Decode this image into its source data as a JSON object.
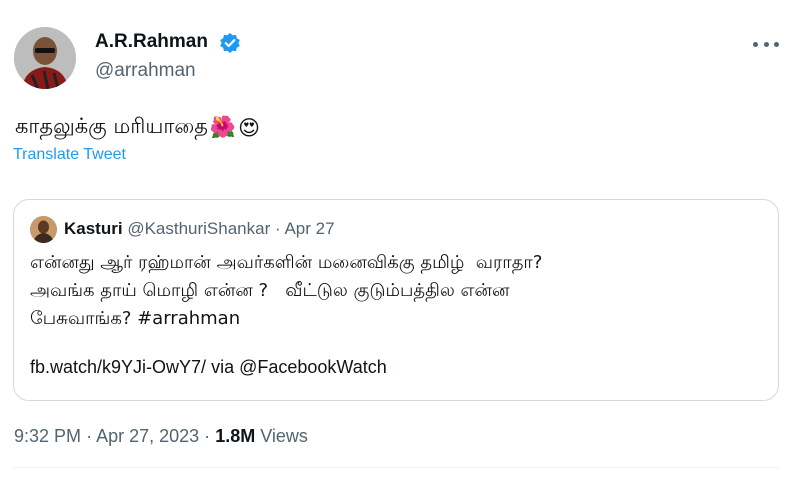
{
  "tweet": {
    "author_name": "A.R.Rahman",
    "author_handle": "@arrahman",
    "verified_icon": "verified-badge-icon",
    "more_icon": "more-options-icon",
    "text": "காதலுக்கு மரியாதை",
    "emojis": [
      "🌺",
      "😍"
    ],
    "translate_label": "Translate Tweet",
    "time": "9:32 PM",
    "sep": "·",
    "date": "Apr 27, 2023",
    "views_count": "1.8M",
    "views_label": "Views"
  },
  "quote": {
    "author_name": "Kasturi",
    "author_handle": "@KasthuriShankar",
    "sep": "·",
    "date": "Apr 27",
    "lines": [
      "என்னது ஆர் ரஹ்மான் அவர்களின் மனைவிக்கு தமிழ்  வராதா?",
      "அவங்க தாய் மொழி என்ன ?   வீட்டுல குடும்பத்தில என்ன",
      "பேசுவாங்க? #arrahman"
    ],
    "link_text": "fb.watch/k9YJi-OwY7/ via @FacebookWatch"
  },
  "colors": {
    "accent": "#1d9bf0",
    "text": "#0f1419",
    "muted": "#536471",
    "border": "#cfd9de"
  }
}
